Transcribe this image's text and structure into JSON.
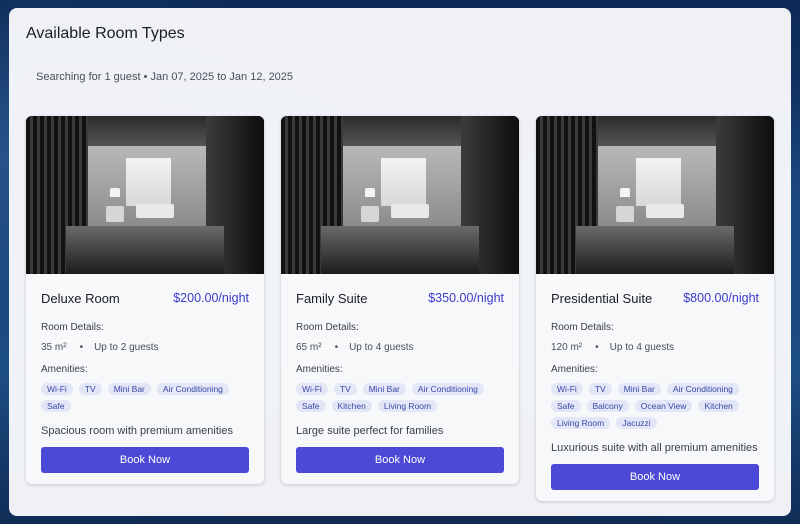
{
  "page": {
    "title": "Available Room Types",
    "search_summary": "Searching for 1 guest • Jan 07, 2025 to Jan 12, 2025"
  },
  "rooms": [
    {
      "name": "Deluxe Room",
      "price": "$200.00/night",
      "details_label": "Room Details:",
      "size": "35 m²",
      "capacity": "Up to 2 guests",
      "amenities_label": "Amenities:",
      "amenities": [
        "Wi-Fi",
        "TV",
        "Mini Bar",
        "Air Conditioning",
        "Safe"
      ],
      "description": "Spacious room with premium amenities",
      "button_label": "Book Now"
    },
    {
      "name": "Family Suite",
      "price": "$350.00/night",
      "details_label": "Room Details:",
      "size": "65 m²",
      "capacity": "Up to 4 guests",
      "amenities_label": "Amenities:",
      "amenities": [
        "Wi-Fi",
        "TV",
        "Mini Bar",
        "Air Conditioning",
        "Safe",
        "Kitchen",
        "Living Room"
      ],
      "description": "Large suite perfect for families",
      "button_label": "Book Now"
    },
    {
      "name": "Presidential Suite",
      "price": "$800.00/night",
      "details_label": "Room Details:",
      "size": "120 m²",
      "capacity": "Up to 4 guests",
      "amenities_label": "Amenities:",
      "amenities": [
        "Wi-Fi",
        "TV",
        "Mini Bar",
        "Air Conditioning",
        "Safe",
        "Balcony",
        "Ocean View",
        "Kitchen",
        "Living Room",
        "Jacuzzi"
      ],
      "description": "Luxurious suite with all premium amenities",
      "button_label": "Book Now"
    }
  ],
  "colors": {
    "accent": "#4b49d6",
    "price": "#3b3bc9",
    "tag_bg": "#e2e6f6",
    "tag_text": "#3b47a8"
  },
  "icons": {
    "separator": "•"
  }
}
